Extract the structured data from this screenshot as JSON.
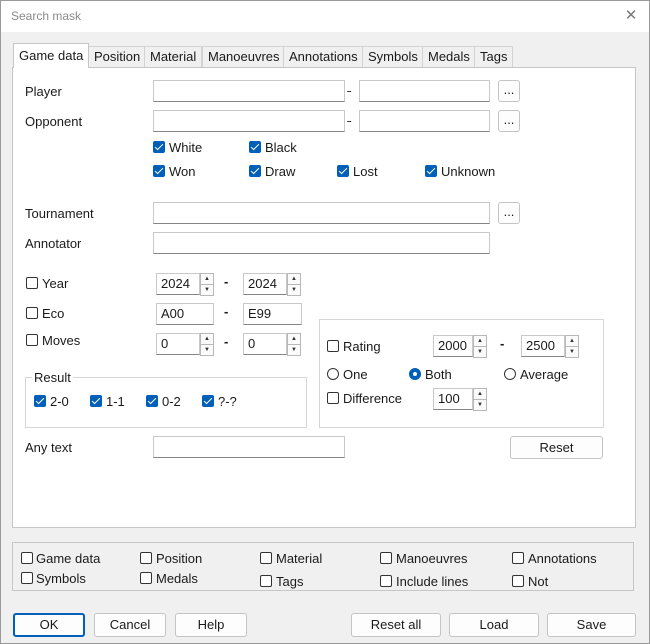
{
  "window": {
    "title": "Search mask",
    "close_glyph": "✕"
  },
  "tabs": [
    "Game data",
    "Position",
    "Material",
    "Manoeuvres",
    "Annotations",
    "Symbols",
    "Medals",
    "Tags"
  ],
  "form": {
    "player_label": "Player",
    "opponent_label": "Opponent",
    "tournament_label": "Tournament",
    "annotator_label": "Annotator",
    "dots": "...",
    "dash": "-",
    "color_white": "White",
    "color_black": "Black",
    "res_won": "Won",
    "res_draw": "Draw",
    "res_lost": "Lost",
    "res_unknown": "Unknown",
    "year_label": "Year",
    "year_from": "2024",
    "year_to": "2024",
    "eco_label": "Eco",
    "eco_from": "A00",
    "eco_to": "E99",
    "moves_label": "Moves",
    "moves_from": "0",
    "moves_to": "0",
    "result_group": "Result",
    "result_1": "2-0",
    "result_2": "1-1",
    "result_3": "0-2",
    "result_4": "?-?",
    "rating_label": "Rating",
    "rating_from": "2000",
    "rating_to": "2500",
    "one_label": "One",
    "both_label": "Both",
    "average_label": "Average",
    "difference_label": "Difference",
    "difference_value": "100",
    "anytext_label": "Any text",
    "reset_label": "Reset"
  },
  "bottom": {
    "game_data": "Game data",
    "position": "Position",
    "material": "Material",
    "manoeuvres": "Manoeuvres",
    "annotations": "Annotations",
    "symbols": "Symbols",
    "medals": "Medals",
    "tags": "Tags",
    "include_lines": "Include lines",
    "not": "Not"
  },
  "footer": {
    "ok": "OK",
    "cancel": "Cancel",
    "help": "Help",
    "reset_all": "Reset all",
    "load": "Load",
    "save": "Save"
  },
  "colors": {
    "accent": "#005fb8"
  }
}
